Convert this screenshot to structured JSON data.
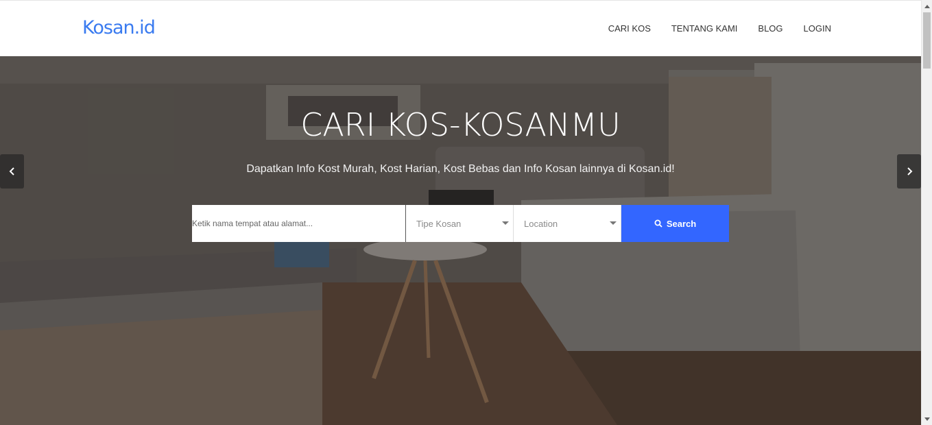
{
  "header": {
    "logo": "Kosan.id",
    "nav": [
      "CARI KOS",
      "TENTANG KAMI",
      "BLOG",
      "LOGIN"
    ]
  },
  "hero": {
    "title": "CARI KOS-KOSANMU",
    "subtitle": "Dapatkan Info Kost Murah, Kost Harian, Kost Bebas dan Info Kosan lainnya di Kosan.id!",
    "prev_icon": "chevron-left-icon",
    "next_icon": "chevron-right-icon"
  },
  "search": {
    "placeholder": "Ketik nama tempat atau alamat...",
    "type_select": "Tipe Kosan",
    "location_select": "Location",
    "button_label": "Search",
    "button_icon": "search-icon"
  },
  "colors": {
    "brand": "#3a7bf0",
    "search_button": "#3366ff"
  }
}
